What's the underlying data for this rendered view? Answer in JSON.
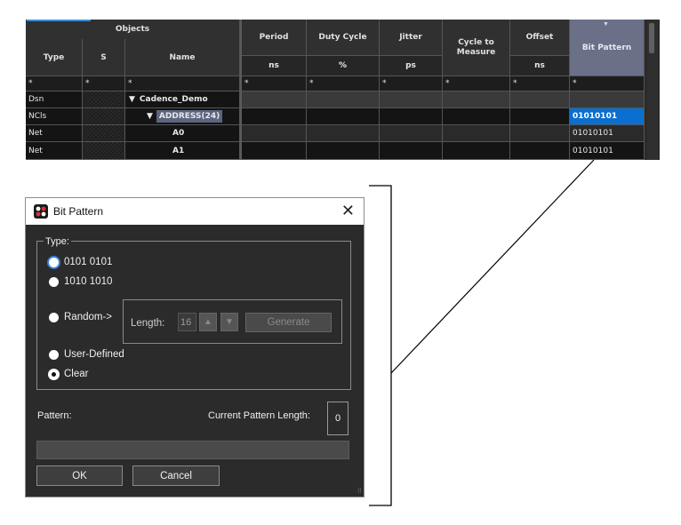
{
  "grid": {
    "headers": {
      "objects": "Objects",
      "type": "Type",
      "s": "S",
      "name": "Name",
      "period": "Period",
      "duty_cycle": "Duty Cycle",
      "jitter": "Jitter",
      "cycle_to_measure": "Cycle to Measure",
      "offset": "Offset",
      "bit_pattern": "Bit Pattern"
    },
    "units": {
      "period": "ns",
      "duty_cycle": "%",
      "jitter": "ps",
      "offset": "ns"
    },
    "filter_symbol": "*",
    "rows": [
      {
        "type": "Dsn",
        "name": "Cadence_Demo",
        "tree": "▼",
        "bit_pattern": ""
      },
      {
        "type": "NCls",
        "name": "ADDRESS(24)",
        "tree": "▼",
        "bit_pattern": "01010101"
      },
      {
        "type": "Net",
        "name": "A0",
        "tree": "",
        "bit_pattern": "01010101"
      },
      {
        "type": "Net",
        "name": "A1",
        "tree": "",
        "bit_pattern": "01010101"
      }
    ],
    "colors": {
      "selected": "#0a6fd0",
      "header_selected": "#6a7088"
    }
  },
  "dialog": {
    "title": "Bit Pattern",
    "close_glyph": "✕",
    "type_label": "Type:",
    "options": {
      "opt1": "0101 0101",
      "opt2": "1010 1010",
      "random": "Random->",
      "user_defined": "User-Defined",
      "clear": "Clear"
    },
    "selected_option": "Clear",
    "length_label": "Length:",
    "length_value": "16",
    "spin_up": "▲",
    "spin_down": "▼",
    "generate_label": "Generate",
    "pattern_label": "Pattern:",
    "pattern_value": "",
    "current_length_label": "Current Pattern Length:",
    "current_length_value": "0",
    "ok_label": "OK",
    "cancel_label": "Cancel"
  }
}
